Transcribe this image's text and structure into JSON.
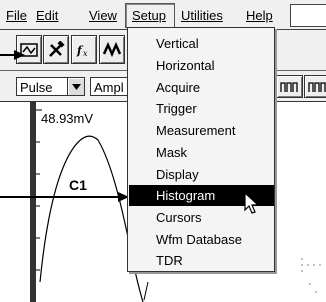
{
  "menubar": {
    "items": [
      {
        "label": "File"
      },
      {
        "label": "Edit"
      },
      {
        "label": "View"
      },
      {
        "label": "Setup"
      },
      {
        "label": "Utilities"
      },
      {
        "label": "Help"
      }
    ]
  },
  "toolbar": {
    "buttons": [
      {
        "icon": "scope-setup-icon"
      },
      {
        "icon": "tools-icon"
      },
      {
        "icon": "function-icon"
      },
      {
        "icon": "waveform-icon"
      }
    ],
    "combo1_value": "Pulse",
    "combo2_value": "Ampl",
    "pulse_icons": [
      "pulse-shape-icon",
      "pulse-shape-icon"
    ]
  },
  "display": {
    "readout": "48.93mV",
    "channel_label": "C1"
  },
  "setup_menu": {
    "items": [
      {
        "label": "Vertical"
      },
      {
        "label": "Horizontal"
      },
      {
        "label": "Acquire"
      },
      {
        "label": "Trigger"
      },
      {
        "label": "Measurement"
      },
      {
        "label": "Mask"
      },
      {
        "label": "Display"
      },
      {
        "label": "Histogram",
        "selected": true
      },
      {
        "label": "Cursors"
      },
      {
        "label": "Wfm Database"
      },
      {
        "label": "TDR"
      }
    ]
  }
}
